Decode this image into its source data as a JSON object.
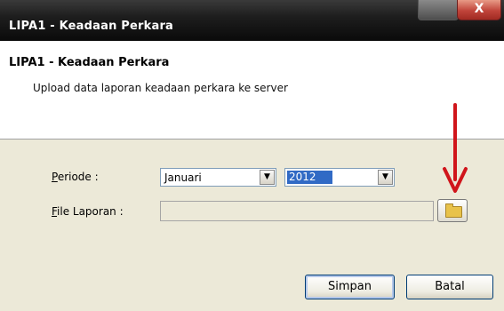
{
  "window": {
    "title": "LIPA1 - Keadaan Perkara",
    "close_glyph": "X"
  },
  "header": {
    "title": "LIPA1 - Keadaan Perkara",
    "subtitle": "Upload data laporan keadaan perkara ke server"
  },
  "form": {
    "periode_label": "Periode :",
    "month_value": "Januari",
    "year_value": "2012",
    "file_label": "File Laporan :",
    "file_value": ""
  },
  "buttons": {
    "save": "Simpan",
    "cancel": "Batal"
  },
  "icons": {
    "browse": "folder-icon",
    "dropdown": "chevron-down-icon",
    "annotation": "red-arrow-down"
  },
  "colors": {
    "annotation_arrow": "#d0151b",
    "selection": "#316ac5"
  }
}
